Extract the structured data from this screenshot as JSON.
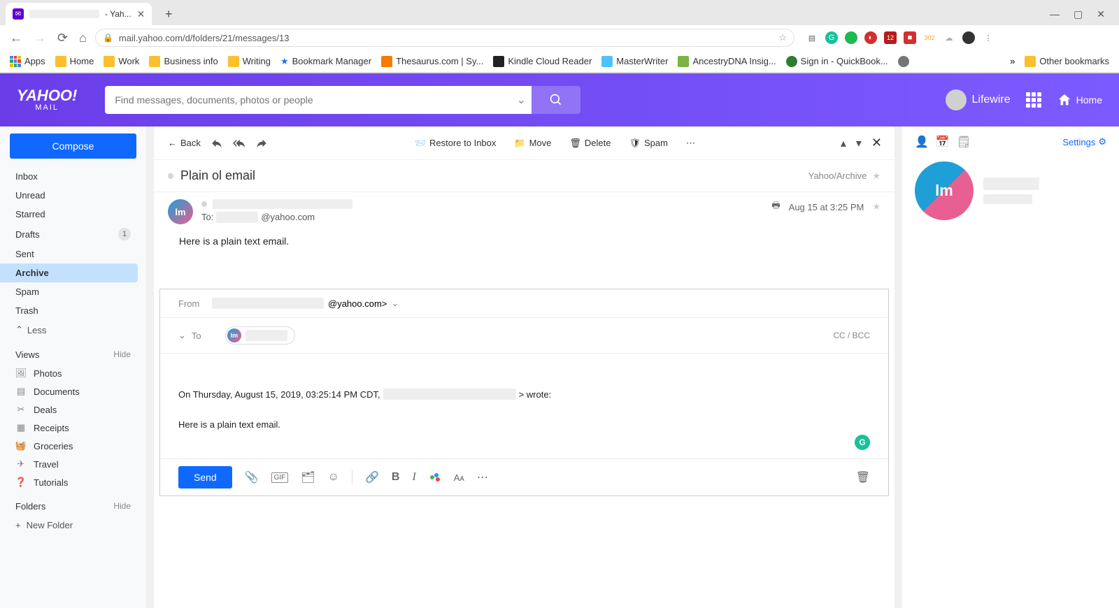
{
  "browser": {
    "tab_title": "- Yah...",
    "url": "mail.yahoo.com/d/folders/21/messages/13",
    "bookmarks": [
      "Apps",
      "Home",
      "Work",
      "Business info",
      "Writing",
      "Bookmark Manager",
      "Thesaurus.com | Sy...",
      "Kindle Cloud Reader",
      "MasterWriter",
      "AncestryDNA Insig...",
      "Sign in - QuickBook..."
    ],
    "other_bookmarks": "Other bookmarks"
  },
  "header": {
    "logo": "YAHOO!",
    "logo_sub": "MAIL",
    "search_placeholder": "Find messages, documents, photos or people",
    "user_label": "Lifewire",
    "home": "Home"
  },
  "sidebar": {
    "compose": "Compose",
    "folders": [
      {
        "name": "Inbox"
      },
      {
        "name": "Unread"
      },
      {
        "name": "Starred"
      },
      {
        "name": "Drafts",
        "count": "1"
      },
      {
        "name": "Sent"
      },
      {
        "name": "Archive",
        "active": true
      },
      {
        "name": "Spam"
      },
      {
        "name": "Trash"
      }
    ],
    "less": "Less",
    "views_label": "Views",
    "hide": "Hide",
    "views": [
      "Photos",
      "Documents",
      "Deals",
      "Receipts",
      "Groceries",
      "Travel",
      "Tutorials"
    ],
    "folders_label": "Folders",
    "new_folder": "New Folder"
  },
  "toolbar": {
    "back": "Back",
    "restore": "Restore to Inbox",
    "move": "Move",
    "delete": "Delete",
    "spam": "Spam"
  },
  "message": {
    "subject": "Plain ol email",
    "folder_path": "Yahoo/Archive",
    "to_label": "To:",
    "to_suffix": "@yahoo.com",
    "date": "Aug 15 at 3:25 PM",
    "body": "Here is a plain text email."
  },
  "compose": {
    "from_label": "From",
    "from_suffix": "@yahoo.com>",
    "to_label": "To",
    "ccbcc": "CC / BCC",
    "quote_prefix": "On Thursday, August 15, 2019, 03:25:14 PM CDT, ",
    "quote_suffix": "> wrote:",
    "quoted_body": "Here is a plain text email.",
    "send": "Send"
  },
  "right_pane": {
    "settings": "Settings"
  }
}
